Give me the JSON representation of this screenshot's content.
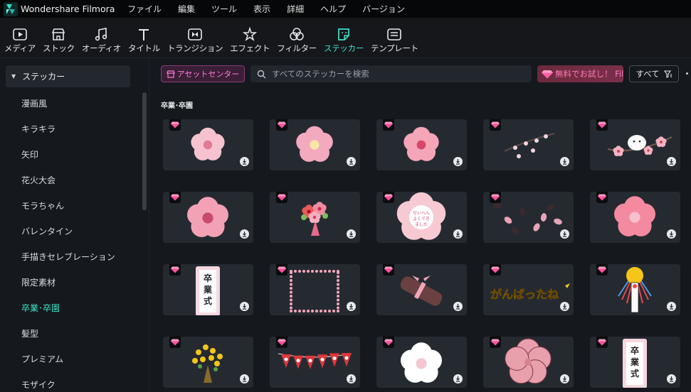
{
  "app": {
    "title": "Wondershare Filmora"
  },
  "menu": [
    "ファイル",
    "編集",
    "ツール",
    "表示",
    "詳細",
    "ヘルプ",
    "バージョン"
  ],
  "toolbar": [
    {
      "label": "メディア",
      "icon": "media-icon"
    },
    {
      "label": "ストック",
      "icon": "stock-store-icon"
    },
    {
      "label": "オーディオ",
      "icon": "audio-note-icon"
    },
    {
      "label": "タイトル",
      "icon": "title-t-icon"
    },
    {
      "label": "トランジション",
      "icon": "transition-icon"
    },
    {
      "label": "エフェクト",
      "icon": "effect-star-icon"
    },
    {
      "label": "フィルター",
      "icon": "filter-icon"
    },
    {
      "label": "ステッカー",
      "icon": "sticker-icon",
      "active": true
    },
    {
      "label": "テンプレート",
      "icon": "template-icon"
    }
  ],
  "sidebar": {
    "header": "ステッカー",
    "items": [
      "漫画風",
      "キラキラ",
      "矢印",
      "花火大会",
      "モラちゃん",
      "バレンタイン",
      "手描きセレブレーション",
      "限定素材",
      "卒業･卒園",
      "髪型",
      "プレミアム",
      "モザイク"
    ],
    "active_index": 8
  },
  "controls": {
    "asset_center": "アセットセンター",
    "search_placeholder": "すべてのステッカーを検索",
    "trial": "無料でお試し！ Fili",
    "filter_all": "すべて"
  },
  "section": {
    "title": "卒業･卒園"
  },
  "colors": {
    "accent": "#3fe2c8",
    "premium": "#ff4fa0",
    "card": "#252a31"
  },
  "stickers": [
    {
      "art": "sakura-pale",
      "text": ""
    },
    {
      "art": "sakura-pink",
      "text": ""
    },
    {
      "art": "sakura-mid",
      "text": ""
    },
    {
      "art": "sakura-branch-dark",
      "text": ""
    },
    {
      "art": "bird-branch",
      "text": ""
    },
    {
      "art": "sakura-large",
      "text": ""
    },
    {
      "art": "bouquet",
      "text": ""
    },
    {
      "art": "sakura-frame-text",
      "text": ""
    },
    {
      "art": "petals-scatter",
      "text": ""
    },
    {
      "art": "sakura-flat",
      "text": ""
    },
    {
      "art": "sign-vertical",
      "text": "卒業式"
    },
    {
      "art": "petal-frame",
      "text": ""
    },
    {
      "art": "diploma",
      "text": ""
    },
    {
      "art": "text-banner",
      "text": "がんばったね"
    },
    {
      "art": "daruma-ribbon",
      "text": ""
    },
    {
      "art": "flower-bouquet-yellow",
      "text": ""
    },
    {
      "art": "bunting",
      "text": ""
    },
    {
      "art": "white-flower",
      "text": ""
    },
    {
      "art": "sakura-outline",
      "text": ""
    },
    {
      "art": "sign-vertical",
      "text": "卒業式"
    }
  ]
}
